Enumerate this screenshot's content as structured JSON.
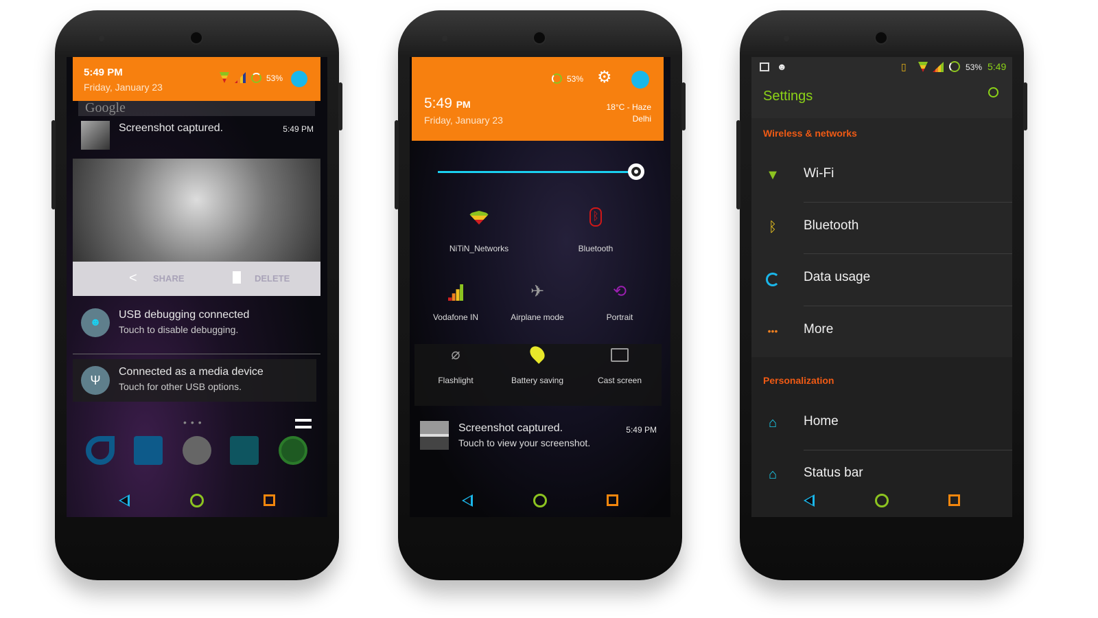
{
  "phone1": {
    "header": {
      "time": "5:49 PM",
      "date": "Friday, January 23",
      "battery": "53%"
    },
    "search_bar_text": "Google",
    "screenshot_notification": {
      "title": "Screenshot captured.",
      "time": "5:49 PM",
      "share_label": "SHARE",
      "delete_label": "DELETE"
    },
    "usb_debug_notification": {
      "title": "USB debugging connected",
      "subtitle": "Touch to disable debugging."
    },
    "media_notification": {
      "title": "Connected as a media device",
      "subtitle": "Touch for other USB options."
    }
  },
  "phone2": {
    "header": {
      "battery": "53%",
      "time": "5:49",
      "ampm": "PM",
      "date": "Friday, January 23",
      "weather": "18°C - Haze",
      "city": "Delhi"
    },
    "brightness_percent": 95,
    "tiles": [
      {
        "label": "NiTiN_Networks",
        "icon": "wifi-icon",
        "color": "#8cc320"
      },
      {
        "label": "Bluetooth",
        "icon": "bluetooth-icon",
        "color": "#d01818"
      },
      {
        "label": "Vodafone IN",
        "icon": "signal-icon",
        "color": "#8cc320"
      },
      {
        "label": "Airplane mode",
        "icon": "airplane-icon",
        "color": "#9a9a9a"
      },
      {
        "label": "Portrait",
        "icon": "rotation-lock-icon",
        "color": "#9b1fb0"
      },
      {
        "label": "Flashlight",
        "icon": "flashlight-off-icon",
        "color": "#9a9a9a"
      },
      {
        "label": "Battery saving",
        "icon": "location-icon",
        "color": "#e8e82a"
      },
      {
        "label": "Cast screen",
        "icon": "cast-icon",
        "color": "#9a9a9a"
      }
    ],
    "notification": {
      "title": "Screenshot captured.",
      "subtitle": "Touch to view your screenshot.",
      "time": "5:49 PM"
    }
  },
  "phone3": {
    "status": {
      "battery": "53%",
      "time": "5:49"
    },
    "title": "Settings",
    "sections": [
      {
        "header": "Wireless & networks",
        "items": [
          {
            "label": "Wi-Fi",
            "icon": "wifi-icon"
          },
          {
            "label": "Bluetooth",
            "icon": "bluetooth-icon"
          },
          {
            "label": "Data usage",
            "icon": "data-usage-icon"
          },
          {
            "label": "More",
            "icon": "more-icon"
          }
        ]
      },
      {
        "header": "Personalization",
        "items": [
          {
            "label": "Home",
            "icon": "home-icon"
          },
          {
            "label": "Status bar",
            "icon": "home-icon"
          }
        ]
      }
    ],
    "colors": {
      "title": "#8cd317",
      "section": "#f05a14",
      "background": "#262626"
    }
  },
  "colors": {
    "header_orange": "#f7800f",
    "nav_back": "#1ab7ea",
    "nav_home": "#8cc320",
    "nav_recent": "#f2860d",
    "avatar": "#1ab7ea"
  }
}
